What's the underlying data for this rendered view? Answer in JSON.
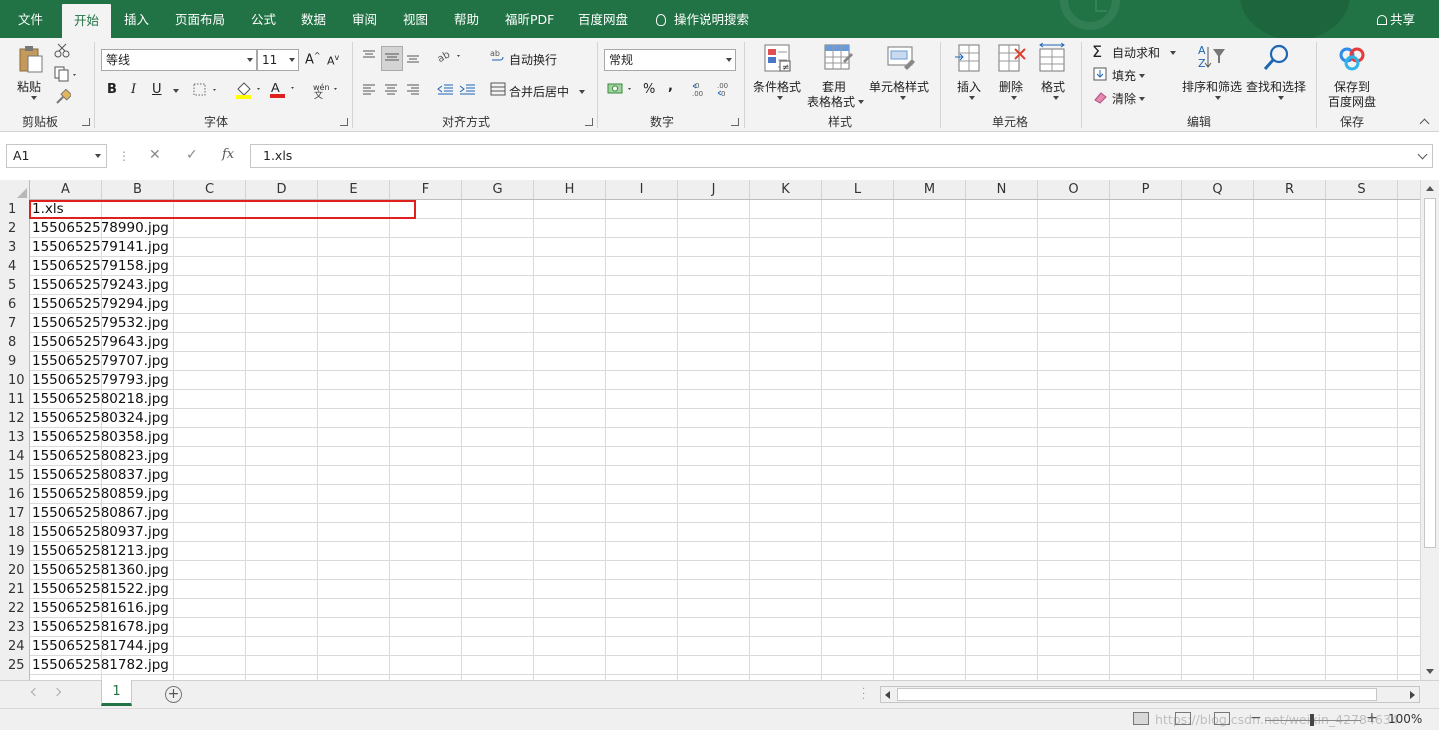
{
  "ribbon_tabs": [
    "文件",
    "开始",
    "插入",
    "页面布局",
    "公式",
    "数据",
    "审阅",
    "视图",
    "帮助",
    "福昕PDF",
    "百度网盘"
  ],
  "tell_me": "操作说明搜索",
  "share": "共享",
  "clipboard": {
    "paste": "粘贴",
    "label": "剪贴板"
  },
  "font": {
    "name": "等线",
    "size": "11",
    "bold": "B",
    "italic": "I",
    "underline": "U",
    "grow": "A",
    "shrink": "A",
    "label": "字体"
  },
  "alignment": {
    "wrap": "自动换行",
    "merge": "合并后居中",
    "label": "对齐方式"
  },
  "number": {
    "format": "常规",
    "percent": "%",
    "comma": ",",
    "inc": "←0\n.00",
    "label": "数字"
  },
  "styles": {
    "conditional": "条件格式",
    "table_l1": "套用",
    "table_l2": "表格格式",
    "cell": "单元格样式",
    "label": "样式"
  },
  "cells": {
    "insert": "插入",
    "delete": "删除",
    "format": "格式",
    "label": "单元格"
  },
  "editing": {
    "autosum": "自动求和",
    "fill": "填充",
    "clear": "清除",
    "sort": "排序和筛选",
    "find": "查找和选择",
    "label": "编辑"
  },
  "save": {
    "l1": "保存到",
    "l2": "百度网盘",
    "label": "保存"
  },
  "name_box": "A1",
  "formula_value": "1.xls",
  "fx": "fx",
  "columns": [
    "A",
    "B",
    "C",
    "D",
    "E",
    "F",
    "G",
    "H",
    "I",
    "J",
    "K",
    "L",
    "M",
    "N",
    "O",
    "P",
    "Q",
    "R",
    "S"
  ],
  "rows": [
    {
      "n": "1",
      "a": "1.xls"
    },
    {
      "n": "2",
      "a": "1550652578990.jpg"
    },
    {
      "n": "3",
      "a": "1550652579141.jpg"
    },
    {
      "n": "4",
      "a": "1550652579158.jpg"
    },
    {
      "n": "5",
      "a": "1550652579243.jpg"
    },
    {
      "n": "6",
      "a": "1550652579294.jpg"
    },
    {
      "n": "7",
      "a": "1550652579532.jpg"
    },
    {
      "n": "8",
      "a": "1550652579643.jpg"
    },
    {
      "n": "9",
      "a": "1550652579707.jpg"
    },
    {
      "n": "10",
      "a": "1550652579793.jpg"
    },
    {
      "n": "11",
      "a": "1550652580218.jpg"
    },
    {
      "n": "12",
      "a": "1550652580324.jpg"
    },
    {
      "n": "13",
      "a": "1550652580358.jpg"
    },
    {
      "n": "14",
      "a": "1550652580823.jpg"
    },
    {
      "n": "15",
      "a": "1550652580837.jpg"
    },
    {
      "n": "16",
      "a": "1550652580859.jpg"
    },
    {
      "n": "17",
      "a": "1550652580867.jpg"
    },
    {
      "n": "18",
      "a": "1550652580937.jpg"
    },
    {
      "n": "19",
      "a": "1550652581213.jpg"
    },
    {
      "n": "20",
      "a": "1550652581360.jpg"
    },
    {
      "n": "21",
      "a": "1550652581522.jpg"
    },
    {
      "n": "22",
      "a": "1550652581616.jpg"
    },
    {
      "n": "23",
      "a": "1550652581678.jpg"
    },
    {
      "n": "24",
      "a": "1550652581744.jpg"
    },
    {
      "n": "25",
      "a": "1550652581782.jpg"
    }
  ],
  "sheet_tab": "1",
  "zoom": "100%",
  "watermark": "https://blog.csdn.net/weixin_42784634",
  "colors": {
    "accent": "#217346",
    "selection": "#e0201c"
  }
}
